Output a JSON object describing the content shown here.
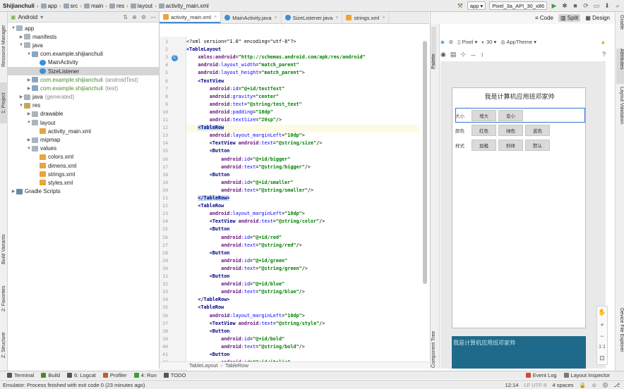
{
  "breadcrumb": [
    "Shijianchuli",
    "app",
    "src",
    "main",
    "res",
    "layout",
    "activity_main.xml"
  ],
  "toolbar": {
    "module": "app",
    "device": "Pixel_3a_API_30_x86"
  },
  "left_tabs": [
    "Resource Manager",
    "1: Project",
    "Build Variants",
    "2: Favorites",
    "Z: Structure"
  ],
  "right_tabs": [
    "Gradle",
    "Attributes",
    "Layout Validation",
    "Device File Explorer"
  ],
  "project_panel": {
    "view": "Android",
    "tree": [
      {
        "label": "app",
        "dim": "",
        "icon": "folder",
        "level": 0,
        "open": true
      },
      {
        "label": "manifests",
        "dim": "",
        "icon": "folder",
        "level": 1,
        "open": false
      },
      {
        "label": "java",
        "dim": "",
        "icon": "folder",
        "level": 1,
        "open": true
      },
      {
        "label": "com.example.shijianchuli",
        "dim": "",
        "icon": "pkg",
        "level": 2,
        "open": true
      },
      {
        "label": "MainActivity",
        "dim": "",
        "icon": "cls",
        "level": 3,
        "open": null
      },
      {
        "label": "SizeListener",
        "dim": "",
        "icon": "cls",
        "level": 3,
        "open": null,
        "selected": true
      },
      {
        "label": "com.example.shijianchuli",
        "dim": "(androidTest)",
        "icon": "pkg",
        "level": 2,
        "open": false
      },
      {
        "label": "com.example.shijianchuli",
        "dim": "(test)",
        "icon": "pkg",
        "level": 2,
        "open": false
      },
      {
        "label": "java",
        "dim": "(generated)",
        "icon": "folder",
        "level": 1,
        "open": false
      },
      {
        "label": "res",
        "dim": "",
        "icon": "res",
        "level": 1,
        "open": true
      },
      {
        "label": "drawable",
        "dim": "",
        "icon": "folder",
        "level": 2,
        "open": false
      },
      {
        "label": "layout",
        "dim": "",
        "icon": "folder",
        "level": 2,
        "open": true
      },
      {
        "label": "activity_main.xml",
        "dim": "",
        "icon": "xml",
        "level": 3,
        "open": null
      },
      {
        "label": "mipmap",
        "dim": "",
        "icon": "folder",
        "level": 2,
        "open": false
      },
      {
        "label": "values",
        "dim": "",
        "icon": "folder",
        "level": 2,
        "open": true
      },
      {
        "label": "colors.xml",
        "dim": "",
        "icon": "xml",
        "level": 3,
        "open": null
      },
      {
        "label": "dimens.xml",
        "dim": "",
        "icon": "xml",
        "level": 3,
        "open": null
      },
      {
        "label": "strings.xml",
        "dim": "",
        "icon": "xml",
        "level": 3,
        "open": null
      },
      {
        "label": "styles.xml",
        "dim": "",
        "icon": "xml",
        "level": 3,
        "open": null
      },
      {
        "label": "Gradle Scripts",
        "dim": "",
        "icon": "grad",
        "level": 0,
        "open": false
      }
    ]
  },
  "editor_tabs": [
    {
      "label": "activity_main.xml",
      "active": true,
      "icon": "xml"
    },
    {
      "label": "MainActivity.java",
      "active": false,
      "icon": "cls"
    },
    {
      "label": "SizeListener.java",
      "active": false,
      "icon": "cls"
    },
    {
      "label": "strings.xml",
      "active": false,
      "icon": "xml"
    }
  ],
  "code_lines": [
    [
      [
        "",
        "<?xml version=\"1.0\" encoding=\"utf-8\"?>"
      ]
    ],
    [
      [
        "tg",
        "<TableLayout"
      ]
    ],
    [
      [
        "",
        "    "
      ],
      [
        "ns",
        "xmlns:android"
      ],
      [
        "",
        "="
      ],
      [
        "av",
        "\"http://schemas.android.com/apk/res/android\""
      ]
    ],
    [
      [
        "",
        "    "
      ],
      [
        "ns",
        "android"
      ],
      [
        "at",
        ":layout_width"
      ],
      [
        "",
        "="
      ],
      [
        "av",
        "\"match_parent\""
      ]
    ],
    [
      [
        "",
        "    "
      ],
      [
        "ns",
        "android"
      ],
      [
        "at",
        ":layout_height"
      ],
      [
        "",
        "="
      ],
      [
        "av",
        "\"match_parent\""
      ],
      [
        "",
        ">"
      ]
    ],
    [
      [
        "",
        "    "
      ],
      [
        "tg",
        "<TextView"
      ]
    ],
    [
      [
        "",
        "        "
      ],
      [
        "ns",
        "android"
      ],
      [
        "at",
        ":id"
      ],
      [
        "",
        "="
      ],
      [
        "av",
        "\"@+id/testText\""
      ]
    ],
    [
      [
        "",
        "        "
      ],
      [
        "ns",
        "android"
      ],
      [
        "at",
        ":gravity"
      ],
      [
        "",
        "="
      ],
      [
        "av",
        "\"center\""
      ]
    ],
    [
      [
        "",
        "        "
      ],
      [
        "ns",
        "android"
      ],
      [
        "at",
        ":text"
      ],
      [
        "",
        "="
      ],
      [
        "av",
        "\"@string/test_text\""
      ]
    ],
    [
      [
        "",
        "        "
      ],
      [
        "ns",
        "android"
      ],
      [
        "at",
        ":padding"
      ],
      [
        "",
        "="
      ],
      [
        "av",
        "\"10dp\""
      ]
    ],
    [
      [
        "",
        "        "
      ],
      [
        "ns",
        "android"
      ],
      [
        "at",
        ":textSize"
      ],
      [
        "",
        "="
      ],
      [
        "av",
        "\"20sp\""
      ],
      [
        "",
        "/>"
      ]
    ],
    [
      [
        "",
        "    "
      ],
      [
        "tg hlt",
        "<TableRow"
      ]
    ],
    [
      [
        "",
        "        "
      ],
      [
        "ns",
        "android"
      ],
      [
        "at",
        ":layout_marginLeft"
      ],
      [
        "",
        "="
      ],
      [
        "av",
        "\"10dp\""
      ],
      [
        "",
        ">"
      ]
    ],
    [
      [
        "",
        "        "
      ],
      [
        "tg",
        "<TextView "
      ],
      [
        "ns",
        "android"
      ],
      [
        "at",
        ":text"
      ],
      [
        "",
        "="
      ],
      [
        "av",
        "\"@string/size\""
      ],
      [
        "",
        "/>"
      ]
    ],
    [
      [
        "",
        "        "
      ],
      [
        "tg",
        "<Button"
      ]
    ],
    [
      [
        "",
        "            "
      ],
      [
        "ns",
        "android"
      ],
      [
        "at",
        ":id"
      ],
      [
        "",
        "="
      ],
      [
        "av",
        "\"@+id/bigger\""
      ]
    ],
    [
      [
        "",
        "            "
      ],
      [
        "ns",
        "android"
      ],
      [
        "at",
        ":text"
      ],
      [
        "",
        "="
      ],
      [
        "av",
        "\"@string/bigger\""
      ],
      [
        "",
        "/>"
      ]
    ],
    [
      [
        "",
        "        "
      ],
      [
        "tg",
        "<Button"
      ]
    ],
    [
      [
        "",
        "            "
      ],
      [
        "ns",
        "android"
      ],
      [
        "at",
        ":id"
      ],
      [
        "",
        "="
      ],
      [
        "av",
        "\"@+id/smaller\""
      ]
    ],
    [
      [
        "",
        "            "
      ],
      [
        "ns",
        "android"
      ],
      [
        "at",
        ":text"
      ],
      [
        "",
        "="
      ],
      [
        "av",
        "\"@string/smaller\""
      ],
      [
        "",
        "/>"
      ]
    ],
    [
      [
        "",
        "    "
      ],
      [
        "tg hlt",
        "</TableRow>"
      ]
    ],
    [
      [
        "",
        "    "
      ],
      [
        "tg",
        "<TableRow"
      ]
    ],
    [
      [
        "",
        "        "
      ],
      [
        "ns",
        "android"
      ],
      [
        "at",
        ":layout_marginLeft"
      ],
      [
        "",
        "="
      ],
      [
        "av",
        "\"10dp\""
      ],
      [
        "",
        ">"
      ]
    ],
    [
      [
        "",
        "        "
      ],
      [
        "tg",
        "<TextView "
      ],
      [
        "ns",
        "android"
      ],
      [
        "at",
        ":text"
      ],
      [
        "",
        "="
      ],
      [
        "av",
        "\"@string/color\""
      ],
      [
        "",
        "/>"
      ]
    ],
    [
      [
        "",
        "        "
      ],
      [
        "tg",
        "<Button"
      ]
    ],
    [
      [
        "",
        "            "
      ],
      [
        "ns",
        "android"
      ],
      [
        "at",
        ":id"
      ],
      [
        "",
        "="
      ],
      [
        "av",
        "\"@+id/red\""
      ]
    ],
    [
      [
        "",
        "            "
      ],
      [
        "ns",
        "android"
      ],
      [
        "at",
        ":text"
      ],
      [
        "",
        "="
      ],
      [
        "av",
        "\"@string/red\""
      ],
      [
        "",
        "/>"
      ]
    ],
    [
      [
        "",
        "        "
      ],
      [
        "tg",
        "<Button"
      ]
    ],
    [
      [
        "",
        "            "
      ],
      [
        "ns",
        "android"
      ],
      [
        "at",
        ":id"
      ],
      [
        "",
        "="
      ],
      [
        "av",
        "\"@+id/green\""
      ]
    ],
    [
      [
        "",
        "            "
      ],
      [
        "ns",
        "android"
      ],
      [
        "at",
        ":text"
      ],
      [
        "",
        "="
      ],
      [
        "av",
        "\"@string/green\""
      ],
      [
        "",
        "/>"
      ]
    ],
    [
      [
        "",
        "        "
      ],
      [
        "tg",
        "<Button"
      ]
    ],
    [
      [
        "",
        "            "
      ],
      [
        "ns",
        "android"
      ],
      [
        "at",
        ":id"
      ],
      [
        "",
        "="
      ],
      [
        "av",
        "\"@+id/blue\""
      ]
    ],
    [
      [
        "",
        "            "
      ],
      [
        "ns",
        "android"
      ],
      [
        "at",
        ":text"
      ],
      [
        "",
        "="
      ],
      [
        "av",
        "\"@string/blue\""
      ],
      [
        "",
        "/>"
      ]
    ],
    [
      [
        "",
        "    "
      ],
      [
        "tg",
        "</TableRow>"
      ]
    ],
    [
      [
        "",
        "    "
      ],
      [
        "tg",
        "<TableRow"
      ]
    ],
    [
      [
        "",
        "        "
      ],
      [
        "ns",
        "android"
      ],
      [
        "at",
        ":layout_marginLeft"
      ],
      [
        "",
        "="
      ],
      [
        "av",
        "\"10dp\""
      ],
      [
        "",
        ">"
      ]
    ],
    [
      [
        "",
        "        "
      ],
      [
        "tg",
        "<TextView "
      ],
      [
        "ns",
        "android"
      ],
      [
        "at",
        ":text"
      ],
      [
        "",
        "="
      ],
      [
        "av",
        "\"@string/style\""
      ],
      [
        "",
        "/>"
      ]
    ],
    [
      [
        "",
        "        "
      ],
      [
        "tg",
        "<Button"
      ]
    ],
    [
      [
        "",
        "            "
      ],
      [
        "ns",
        "android"
      ],
      [
        "at",
        ":id"
      ],
      [
        "",
        "="
      ],
      [
        "av",
        "\"@+id/bold\""
      ]
    ],
    [
      [
        "",
        "            "
      ],
      [
        "ns",
        "android"
      ],
      [
        "at",
        ":text"
      ],
      [
        "",
        "="
      ],
      [
        "av",
        "\"@string/bold\""
      ],
      [
        "",
        "/>"
      ]
    ],
    [
      [
        "",
        "        "
      ],
      [
        "tg",
        "<Button"
      ]
    ],
    [
      [
        "",
        "            "
      ],
      [
        "ns",
        "android"
      ],
      [
        "at",
        ":id"
      ],
      [
        "",
        "="
      ],
      [
        "av",
        "\"@+id/italic\""
      ]
    ]
  ],
  "editor_breadcrumb": [
    "TableLayout",
    "TableRow"
  ],
  "design": {
    "modes": [
      "Code",
      "Split",
      "Design"
    ],
    "active_mode": "Split",
    "palette_label": "Palette",
    "component_tree_label": "Component Tree",
    "device": "Pixel",
    "api": "30",
    "theme": "AppTheme",
    "preview": {
      "title": "我是计算机应用班邓家帅",
      "rows": [
        {
          "label": "大小",
          "buttons": [
            "增大",
            "变小"
          ]
        },
        {
          "label": "颜色",
          "buttons": [
            "红色",
            "绿色",
            "蓝色"
          ]
        },
        {
          "label": "样式",
          "buttons": [
            "加粗",
            "斜体",
            "默认"
          ]
        }
      ]
    },
    "blueprint_title": "我是计算机应用班邓家帅"
  },
  "bottom_tools": [
    "Terminal",
    "Build",
    "6: Logcat",
    "Profiler",
    "4: Run",
    "TODO"
  ],
  "bottom_right_tools": [
    "Event Log",
    "Layout Inspector"
  ],
  "status": {
    "message": "Emulator: Process finished with exit code 0 (23 minutes ago)",
    "position": "12:14",
    "encoding": "LF   UTF-8",
    "indent": "4 spaces"
  }
}
